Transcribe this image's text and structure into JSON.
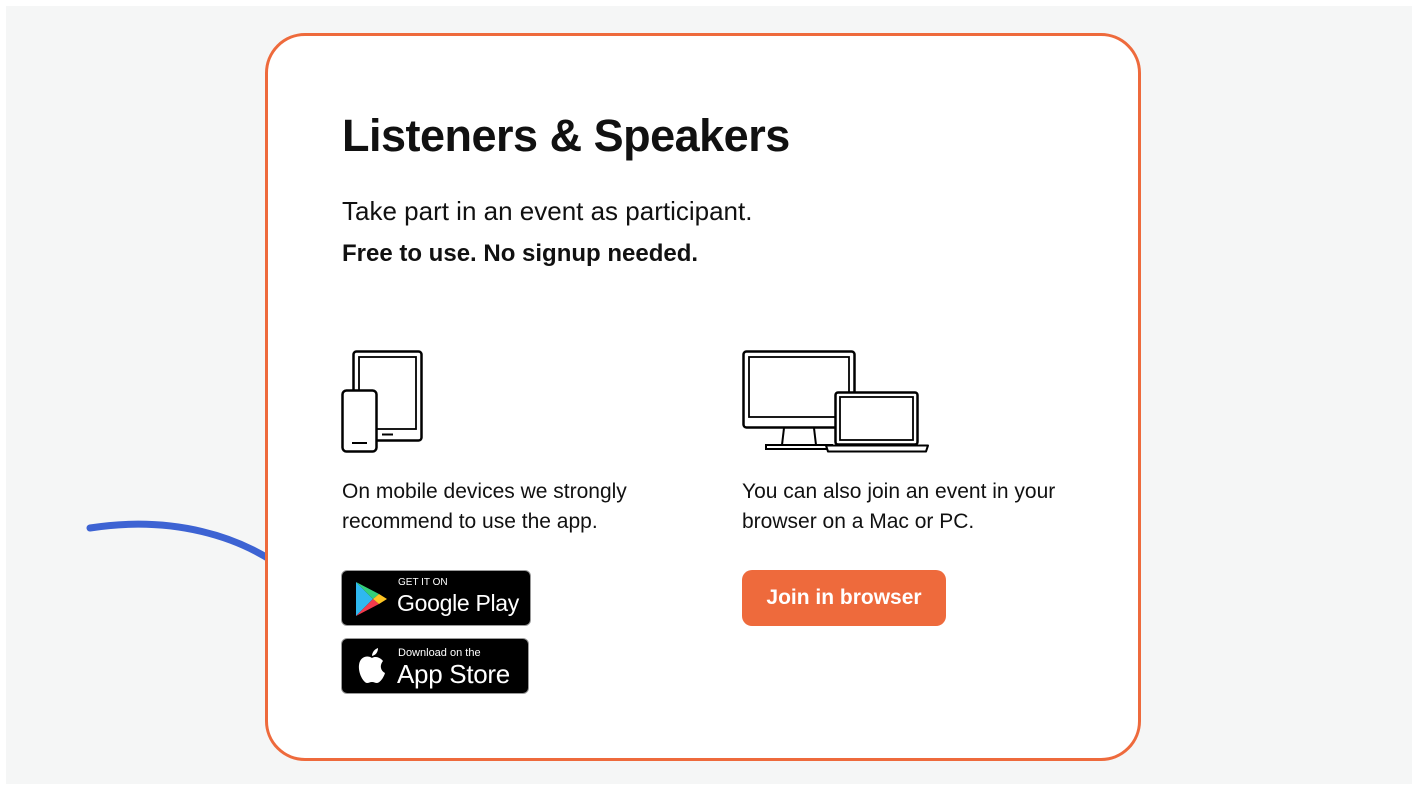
{
  "card": {
    "title": "Listeners & Speakers",
    "subtitle": "Take part in an event as participant.",
    "subtitle_bold": "Free to use. No signup needed."
  },
  "mobile": {
    "icon": "tablet-phone-icon",
    "text": "On mobile devices we strongly recommend to use the app.",
    "google_play": {
      "small": "GET IT ON",
      "big": "Google Play",
      "icon": "google-play-icon"
    },
    "app_store": {
      "small": "Download on the",
      "big": "App Store",
      "icon": "apple-icon"
    }
  },
  "desktop": {
    "icon": "desktop-laptop-icon",
    "text": "You can also join an event in your browser on a Mac or PC.",
    "join_button": "Join in browser"
  },
  "annotation": {
    "icon": "hand-drawn-arrow-icon"
  },
  "colors": {
    "accent": "#ee6a3c",
    "arrow": "#3d63d3",
    "text": "#111111",
    "page_background": "#f5f6f6"
  }
}
